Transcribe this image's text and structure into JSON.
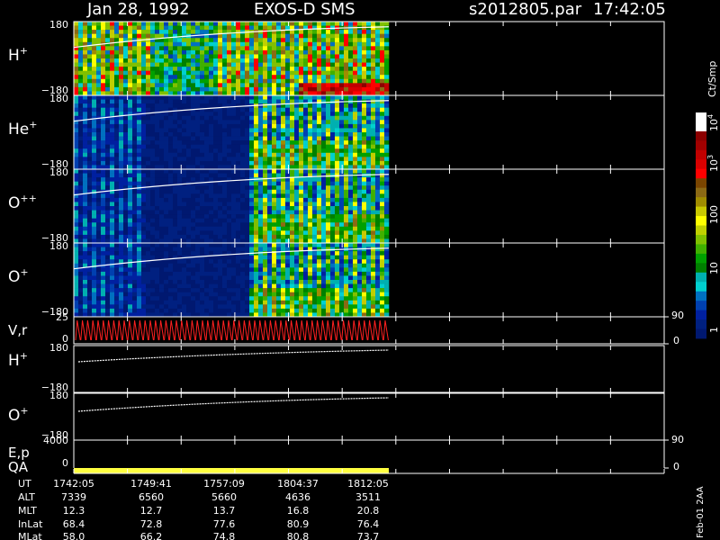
{
  "header": {
    "date": "Jan 28, 1992",
    "instrument": "EXOS-D SMS",
    "file": "s2012805.par",
    "time": "17:42:05"
  },
  "panels": [
    {
      "label_main": "H",
      "label_sup": "+",
      "top": "180",
      "bottom": "−180"
    },
    {
      "label_main": "He",
      "label_sup": "+",
      "top": "180",
      "bottom": "−180"
    },
    {
      "label_main": "O",
      "label_sup": "++",
      "top": "180",
      "bottom": "−180"
    },
    {
      "label_main": "O",
      "label_sup": "+",
      "top": "180",
      "bottom": "−180"
    }
  ],
  "vr": {
    "label": "V,r",
    "top": "25",
    "bottom": "0",
    "right_top": "90",
    "right_bottom": "0"
  },
  "line_panels": [
    {
      "label_main": "H",
      "label_sup": "+",
      "top": "180",
      "bottom": "−180"
    },
    {
      "label_main": "O",
      "label_sup": "+",
      "top": "180",
      "bottom": "−180"
    }
  ],
  "ep": {
    "label": "E,p",
    "top": "4000",
    "right_top": "90"
  },
  "qa": {
    "label": "QA",
    "left_bottom": "0",
    "right_bottom": "0"
  },
  "colorbar": {
    "title": "Ct/Smp",
    "ticks": [
      "10",
      "10",
      "100",
      "10",
      "1"
    ],
    "tick_sup": [
      "4",
      "3",
      "",
      "",
      ""
    ],
    "colors": [
      "#ffffff",
      "#ffffff",
      "#8b0000",
      "#a00000",
      "#c00000",
      "#d80000",
      "#ff0000",
      "#7a4500",
      "#8b6914",
      "#a08c00",
      "#c8c800",
      "#ffff00",
      "#c0d000",
      "#80c000",
      "#40b000",
      "#00a000",
      "#008000",
      "#00b0b0",
      "#00d0d0",
      "#0070c0",
      "#0040b0",
      "#0020a0",
      "#002080",
      "#001870"
    ]
  },
  "x_axis": {
    "row_labels": [
      "UT",
      "ALT",
      "MLT",
      "InLat",
      "MLat"
    ],
    "columns": [
      [
        "1742:05",
        "7339",
        "12.3",
        "68.4",
        "58.0"
      ],
      [
        "1749:41",
        "6560",
        "12.7",
        "72.8",
        "66.2"
      ],
      [
        "1757:09",
        "5660",
        "13.7",
        "77.6",
        "74.8"
      ],
      [
        "1804:37",
        "4636",
        "16.8",
        "80.9",
        "80.8"
      ],
      [
        "1812:05",
        "3511",
        "20.8",
        "76.4",
        "73.7"
      ]
    ]
  },
  "footer": "Feb-01 2AA",
  "chart_data": {
    "type": "heatmap",
    "x": [
      "1742:05",
      "1749:41",
      "1757:09",
      "1804:37",
      "1812:05"
    ],
    "series": [
      {
        "name": "H+",
        "ylim": [
          -180,
          180
        ]
      },
      {
        "name": "He+",
        "ylim": [
          -180,
          180
        ]
      },
      {
        "name": "O++",
        "ylim": [
          -180,
          180
        ]
      },
      {
        "name": "O+",
        "ylim": [
          -180,
          180
        ]
      },
      {
        "name": "V,r",
        "ylim": [
          0,
          25
        ]
      }
    ],
    "colorbar_label": "Ct/Smp",
    "colorbar_range": [
      1,
      10000
    ],
    "colorbar_scale": "log"
  }
}
